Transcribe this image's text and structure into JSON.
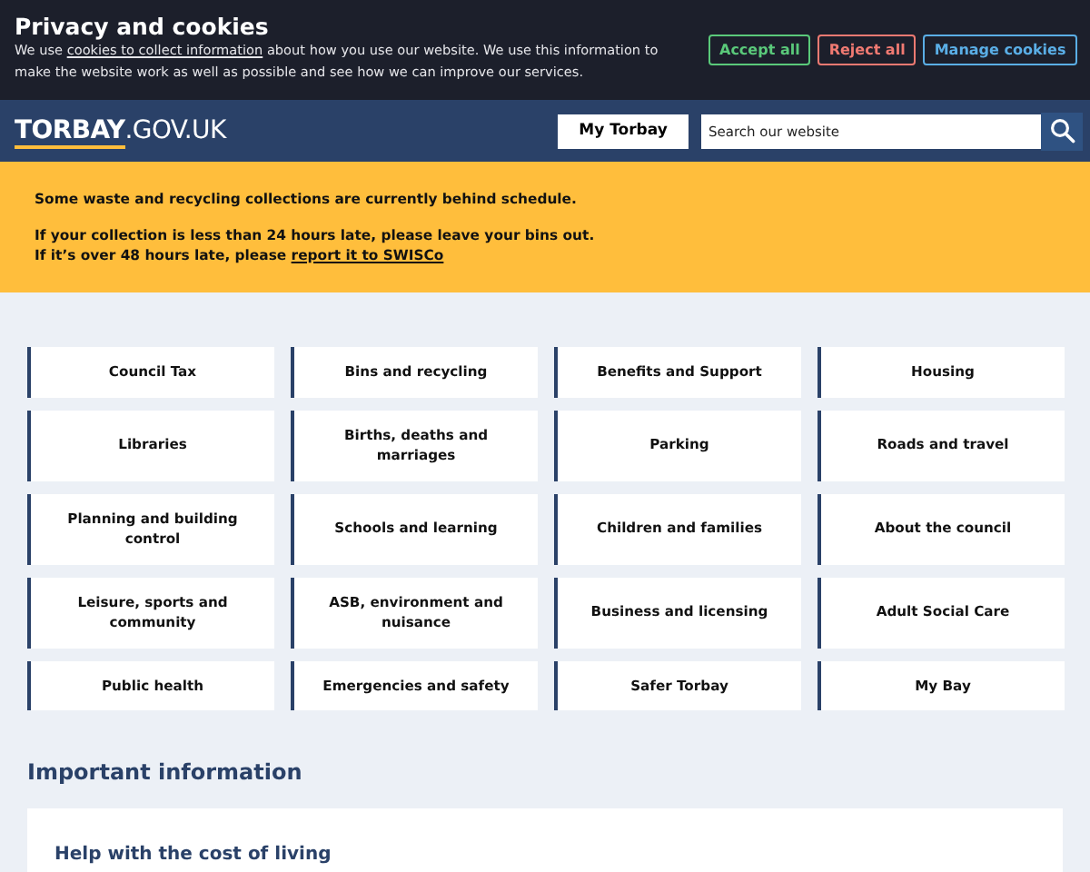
{
  "cookie_banner": {
    "title": "Privacy and cookies",
    "text_before": "We use ",
    "link": "cookies to collect information",
    "text_after": " about how you use our website. We use this information to make the website work as well as possible and see how we can improve our services.",
    "buttons": [
      {
        "label": "Accept all",
        "kind": "accept"
      },
      {
        "label": "Reject all",
        "kind": "reject"
      },
      {
        "label": "Manage cookies",
        "kind": "manage"
      }
    ]
  },
  "header": {
    "logo_bold": "TORBAY",
    "logo_rest": ".GOV.UK",
    "account_button": "My Torbay",
    "search": {
      "placeholder": "Search our website"
    }
  },
  "alert": {
    "paragraphs": [
      [
        {
          "text": "Some waste and recycling collections are currently behind schedule."
        }
      ],
      [
        {
          "text": "If your collection is less than 24 hours late, please leave your bins out."
        },
        {
          "text": "If it’s over 48 hours late, please ",
          "link": "report it to SWISCo "
        }
      ]
    ]
  },
  "services": [
    "Council Tax",
    "Bins and recycling",
    "Benefits and Support",
    "Housing",
    "Libraries",
    "Births, deaths and marriages",
    "Parking",
    "Roads and travel",
    "Planning and building control",
    "Schools and learning",
    "Children and families",
    "About the council",
    "Leisure, sports and community",
    "ASB, environment and nuisance",
    "Business and licensing",
    "Adult Social Care",
    "Public health",
    "Emergencies and safety",
    "Safer Torbay",
    "My Bay"
  ],
  "important": {
    "heading": "Important information",
    "card_title": "Help with the cost of living"
  }
}
